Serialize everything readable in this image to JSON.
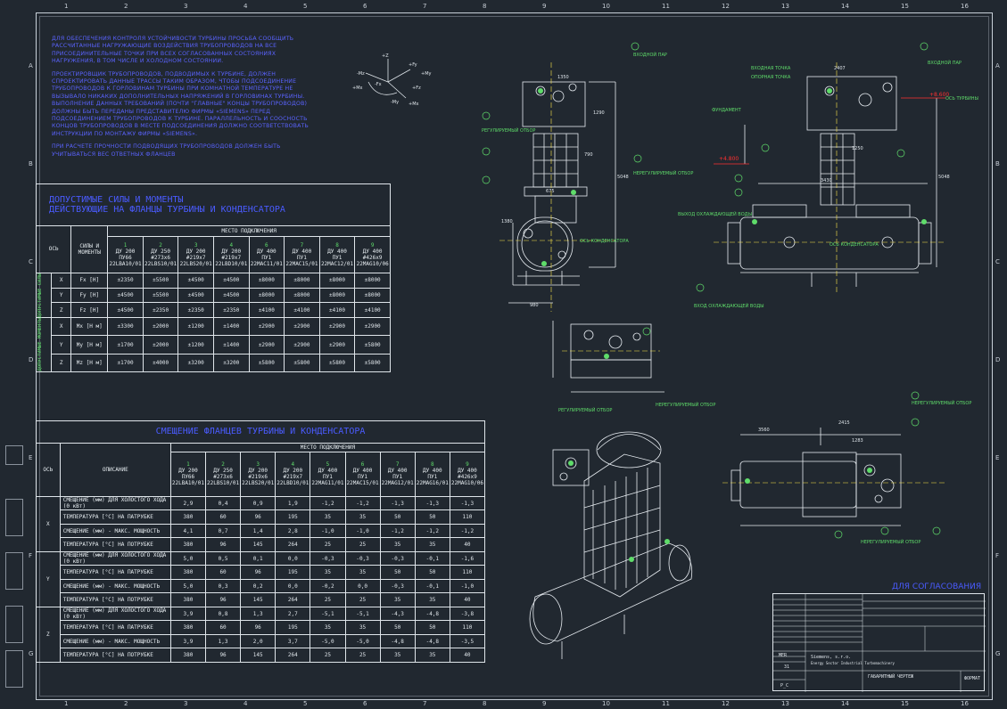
{
  "notes": [
    "ДЛЯ ОБЕСПЕЧЕНИЯ КОНТРОЛЯ УСТОЙЧИВОСТИ ТУРБИНЫ ПРОСЬБА СООБЩИТЬ РАССЧИТАННЫЕ НАГРУЖАЮЩИЕ ВОЗДЕЙСТВИЯ ТРУБОПРОВОДОВ НА ВСЕ ПРИСОЕДИНИТЕЛЬНЫЕ ТОЧКИ ПРИ ВСЕХ СОГЛАСОВАННЫХ СОСТОЯНИЯХ НАГРУЖЕНИЯ, В ТОМ ЧИСЛЕ И ХОЛОДНОМ СОСТОЯНИИ.",
    "ПРОЕКТИРОВЩИК ТРУБОПРОВОДОВ, ПОДВОДИМЫХ К ТУРБИНЕ, ДОЛЖЕН СПРОЕКТИРОВАТЬ ДАННЫЕ ТРАССЫ ТАКИМ ОБРАЗОМ, ЧТОБЫ ПОДСОЕДИНЕНИЕ ТРУБОПРОВОДОВ К ГОРЛОВИНАМ ТУРБИНЫ ПРИ КОМНАТНОЙ ТЕМПЕРАТУРЕ НЕ ВЫЗЫВАЛО НИКАКИХ ДОПОЛНИТЕЛЬНЫХ НАПРЯЖЕНИЙ В ГОРЛОВИНАХ ТУРБИНЫ. ВЫПОЛНЕНИЕ ДАННЫХ ТРЕБОВАНИЙ (ПОЧТИ \"ГЛАВНЫЕ\" КОНЦЫ ТРУБОПРОВОДОВ) ДОЛЖНЫ БЫТЬ ПЕРЕДАНЫ ПРЕДСТАВИТЕЛЮ ФИРМЫ «SIEMENS» ПЕРЕД ПОДСОЕДИНЕНИЕМ ТРУБОПРОВОДОВ К ТУРБИНЕ. ПАРАЛЛЕЛЬНОСТЬ И СООСНОСТЬ КОНЦОВ ТРУБОПРОВОДОВ В МЕСТЕ ПОДСОЕДИНЕНИЯ ДОЛЖНО СООТВЕТСТВОВАТЬ ИНСТРУКЦИИ ПО МОНТАЖУ ФИРМЫ «SIEMENS».",
    "ПРИ РАСЧЕТЕ ПРОЧНОСТИ ПОДВОДЯЩИХ ТРУБОПРОВОДОВ ДОЛЖЕН БЫТЬ УЧИТЫВАТЬСЯ ВЕС ОТВЕТНЫХ ФЛАНЦЕВ"
  ],
  "table1": {
    "title1": "ДОПУСТИМЫЕ СИЛЫ И МОМЕНТЫ",
    "title2": "ДЕЙСТВУЮЩИЕ НА ФЛАНЦЫ ТУРБИНЫ И КОНДЕНСАТОРА",
    "axis_header": "ОСЬ",
    "forces_header": "СИЛЫ И МОМЕНТЫ",
    "place_header": "МЕСТО ПОДКЛЮЧЕНИЯ",
    "group_forces": "ДОПУСТИМЫЕ СИЛЫ",
    "group_moments": "ДОПУСТИМЫЕ МОМЕНТЫ",
    "columns": [
      {
        "n": "1",
        "d": "ДУ 200",
        "s": "ПУ66",
        "c": "22LBA10/01"
      },
      {
        "n": "2",
        "d": "ДУ 250",
        "s": "#273x6",
        "c": "22LBS10/01"
      },
      {
        "n": "3",
        "d": "ДУ 200",
        "s": "#219x7",
        "c": "22LBS20/01"
      },
      {
        "n": "4",
        "d": "ДУ 200",
        "s": "#219x7",
        "c": "22LBD10/01"
      },
      {
        "n": "6",
        "d": "ДУ 400",
        "s": "ПУ1",
        "c": "22MAC11/01"
      },
      {
        "n": "7",
        "d": "ДУ 400",
        "s": "ПУ1",
        "c": "22MAC15/01"
      },
      {
        "n": "8",
        "d": "ДУ 400",
        "s": "ПУ1",
        "c": "22MAC12/01"
      },
      {
        "n": "9",
        "d": "ДУ 400",
        "s": "#426x9",
        "c": "22MAG10/06"
      }
    ],
    "rows": [
      {
        "axis": "X",
        "label": "Fx [Н]",
        "vals": [
          "±2350",
          "±5500",
          "±4500",
          "±4500",
          "±8000",
          "±8000",
          "±8000",
          "±8000"
        ]
      },
      {
        "axis": "Y",
        "label": "Fy [Н]",
        "vals": [
          "±4500",
          "±5500",
          "±4500",
          "±4500",
          "±8000",
          "±8000",
          "±8000",
          "±8000"
        ]
      },
      {
        "axis": "Z",
        "label": "Fz [Н]",
        "vals": [
          "±4500",
          "±2350",
          "±2350",
          "±2350",
          "±4100",
          "±4100",
          "±4100",
          "±4100"
        ]
      },
      {
        "axis": "X",
        "label": "Mx [Н м]",
        "vals": [
          "±3300",
          "±2000",
          "±1200",
          "±1400",
          "±2900",
          "±2900",
          "±2900",
          "±2900"
        ]
      },
      {
        "axis": "Y",
        "label": "My [Н м]",
        "vals": [
          "±1700",
          "±2000",
          "±1200",
          "±1400",
          "±2900",
          "±2900",
          "±2900",
          "±5800"
        ]
      },
      {
        "axis": "Z",
        "label": "Mz [Н м]",
        "vals": [
          "±1700",
          "±4000",
          "±3200",
          "±3200",
          "±5800",
          "±5800",
          "±5800",
          "±5800"
        ]
      }
    ]
  },
  "table2": {
    "title": "СМЕЩЕНИЕ ФЛАНЦЕВ ТУРБИНЫ И КОНДЕНСАТОРА",
    "axis_header": "ОСЬ",
    "desc_header": "ОПИСАНИЕ",
    "place_header": "МЕСТО ПОДКЛЮЧЕНИЯ",
    "columns": [
      {
        "n": "1",
        "d": "ДУ 200",
        "s": "ПУ66",
        "c": "22LBA10/01"
      },
      {
        "n": "2",
        "d": "ДУ 250",
        "s": "#273x6",
        "c": "22LBS10/01"
      },
      {
        "n": "3",
        "d": "ДУ 200",
        "s": "#219x6",
        "c": "22LBS20/01"
      },
      {
        "n": "4",
        "d": "ДУ 200",
        "s": "#219x7",
        "c": "22LBD10/01"
      },
      {
        "n": "5",
        "d": "ДУ 400",
        "s": "ПУ1",
        "c": "22MAG11/01"
      },
      {
        "n": "6",
        "d": "ДУ 400",
        "s": "ПУ1",
        "c": "22MAC15/01"
      },
      {
        "n": "7",
        "d": "ДУ 400",
        "s": "ПУ1",
        "c": "22MAG12/01"
      },
      {
        "n": "8",
        "d": "ДУ 400",
        "s": "ПУ1",
        "c": "22MAG16/01"
      },
      {
        "n": "9",
        "d": "ДУ 400",
        "s": "#426x9",
        "c": "22MAG10/06"
      }
    ],
    "groups": [
      {
        "axis": "X",
        "rows": [
          {
            "label": "СМЕЩЕНИЕ (мм) ДЛЯ ХОЛОСТОГО ХОДА (0 кВт)",
            "vals": [
              "2,9",
              "0,4",
              "0,9",
              "1,9",
              "-1,2",
              "-1,2",
              "-1,3",
              "-1,3",
              "-1,3"
            ]
          },
          {
            "label": "ТЕМПЕРАТУРА [°С] НА ПАТРУБКЕ",
            "vals": [
              "380",
              "60",
              "96",
              "195",
              "35",
              "35",
              "50",
              "50",
              "110"
            ]
          },
          {
            "label": "СМЕЩЕНИЕ (мм) - МАКС. МОЩНОСТЬ",
            "vals": [
              "4,1",
              "0,7",
              "1,4",
              "2,8",
              "-1,0",
              "-1,0",
              "-1,2",
              "-1,2",
              "-1,2"
            ]
          },
          {
            "label": "ТЕМПЕРАТУРА [°С] НА ПОТРУБКЕ",
            "vals": [
              "380",
              "96",
              "145",
              "264",
              "25",
              "25",
              "35",
              "35",
              "40"
            ]
          }
        ]
      },
      {
        "axis": "Y",
        "rows": [
          {
            "label": "СМЕЩЕНИЕ (мм) ДЛЯ ХОЛОСТОГО ХОДА (0 кВт)",
            "vals": [
              "5,0",
              "0,5",
              "0,1",
              "0,0",
              "-0,3",
              "-0,3",
              "-0,3",
              "-0,1",
              "-1,6"
            ]
          },
          {
            "label": "ТЕМПЕРАТУРА [°С] НА ПАТРУБКЕ",
            "vals": [
              "380",
              "60",
              "96",
              "195",
              "35",
              "35",
              "50",
              "50",
              "110"
            ]
          },
          {
            "label": "СМЕЩЕНИЕ (мм) - МАКС. МОЩНОСТЬ",
            "vals": [
              "5,0",
              "0,3",
              "0,2",
              "0,0",
              "-0,2",
              "0,0",
              "-0,3",
              "-0,1",
              "-1,0"
            ]
          },
          {
            "label": "ТЕМПЕРАТУРА [°С] НА ПОТРУБКЕ",
            "vals": [
              "380",
              "96",
              "145",
              "264",
              "25",
              "25",
              "35",
              "35",
              "40"
            ]
          }
        ]
      },
      {
        "axis": "Z",
        "rows": [
          {
            "label": "СМЕЩЕНИЕ (мм) ДЛЯ ХОЛОСТОГО ХОДА (0 кВт)",
            "vals": [
              "3,9",
              "0,8",
              "1,3",
              "2,7",
              "-5,1",
              "-5,1",
              "-4,3",
              "-4,8",
              "-3,8"
            ]
          },
          {
            "label": "ТЕМПЕРАТУРА [°С] НА ПАТРУБКЕ",
            "vals": [
              "380",
              "60",
              "96",
              "195",
              "35",
              "35",
              "50",
              "50",
              "110"
            ]
          },
          {
            "label": "СМЕЩЕНИЕ (мм) - МАКС. МОЩНОСТЬ",
            "vals": [
              "3,9",
              "1,3",
              "2,0",
              "3,7",
              "-5,0",
              "-5,0",
              "-4,8",
              "-4,8",
              "-3,5"
            ]
          },
          {
            "label": "ТЕМПЕРАТУРА [°С] НА ПОТРУБКЕ",
            "vals": [
              "380",
              "96",
              "145",
              "264",
              "25",
              "25",
              "35",
              "35",
              "40"
            ]
          }
        ]
      }
    ]
  },
  "axes_symbol": {
    "labels": [
      "+Z",
      "-Mz",
      "+Mx",
      "+Fy",
      "+My",
      "-My",
      "+Mx",
      "-Fx",
      "+Fz"
    ]
  },
  "dimensions": {
    "top_left": [
      "1350",
      "1290",
      "790",
      "5048",
      "980",
      "1380",
      "675",
      "4",
      "14"
    ],
    "top_right": [
      "2407",
      "1250",
      "3430",
      "5048",
      "3560",
      "918",
      "1283",
      "5000"
    ],
    "bottom_right": [
      "3560",
      "2415",
      "1283"
    ]
  },
  "callouts": [
    "ДУ 200, ПУ6",
    "ВХОДНОЙ ПАР",
    "ДУ 250, #273x6",
    "РЕГУЛИРУЕМЫЙ ОТБОР",
    "ДУ 400, ПУ1",
    "ВЫХОД ОХЛАЖДАЮЩЕЙ ВОДЫ",
    "ВХОД ОХЛАЖДАЮЩЕЙ ВОДЫ",
    "НЕРЕГУЛИРУЕМЫЙ ОТБОР",
    "ОСЬ ТУРБИНЫ",
    "ОСЬ КОНДЕНСАТОРА",
    "ФУНДАМЕНТ",
    "ВХОДНАЯ ТОЧКА",
    "ОПОРНАЯ ТОЧКА"
  ],
  "elevations": [
    "+4.800",
    "+8.600"
  ],
  "ruler_numbers": [
    "1",
    "2",
    "3",
    "4",
    "5",
    "6",
    "7",
    "8",
    "9",
    "10",
    "11",
    "12",
    "13",
    "14",
    "15",
    "16"
  ],
  "ruler_letters": [
    "A",
    "B",
    "C",
    "D",
    "E",
    "F",
    "G"
  ],
  "agree_title": "ДЛЯ СОГЛАСОВАНИЯ",
  "title_block": {
    "mer": "MER",
    "sheet": "31",
    "company": "Siemens, s.r.o.",
    "subtitle": "Energy Sector Industrial Turbomachinery",
    "doc_type": "ГАБАРИТНЫЙ ЧЕРТЕЖ",
    "format": "P_C",
    "scale": "ФОРМАТ"
  },
  "colors": {
    "background": "#212830",
    "frame": "#c8d0d8",
    "note_text": "#5a63ff",
    "drawing_line": "#e8edf2",
    "accent_green": "#5fdc6a",
    "accent_red": "#ff3030",
    "accent_yellow": "#ffe84a"
  }
}
